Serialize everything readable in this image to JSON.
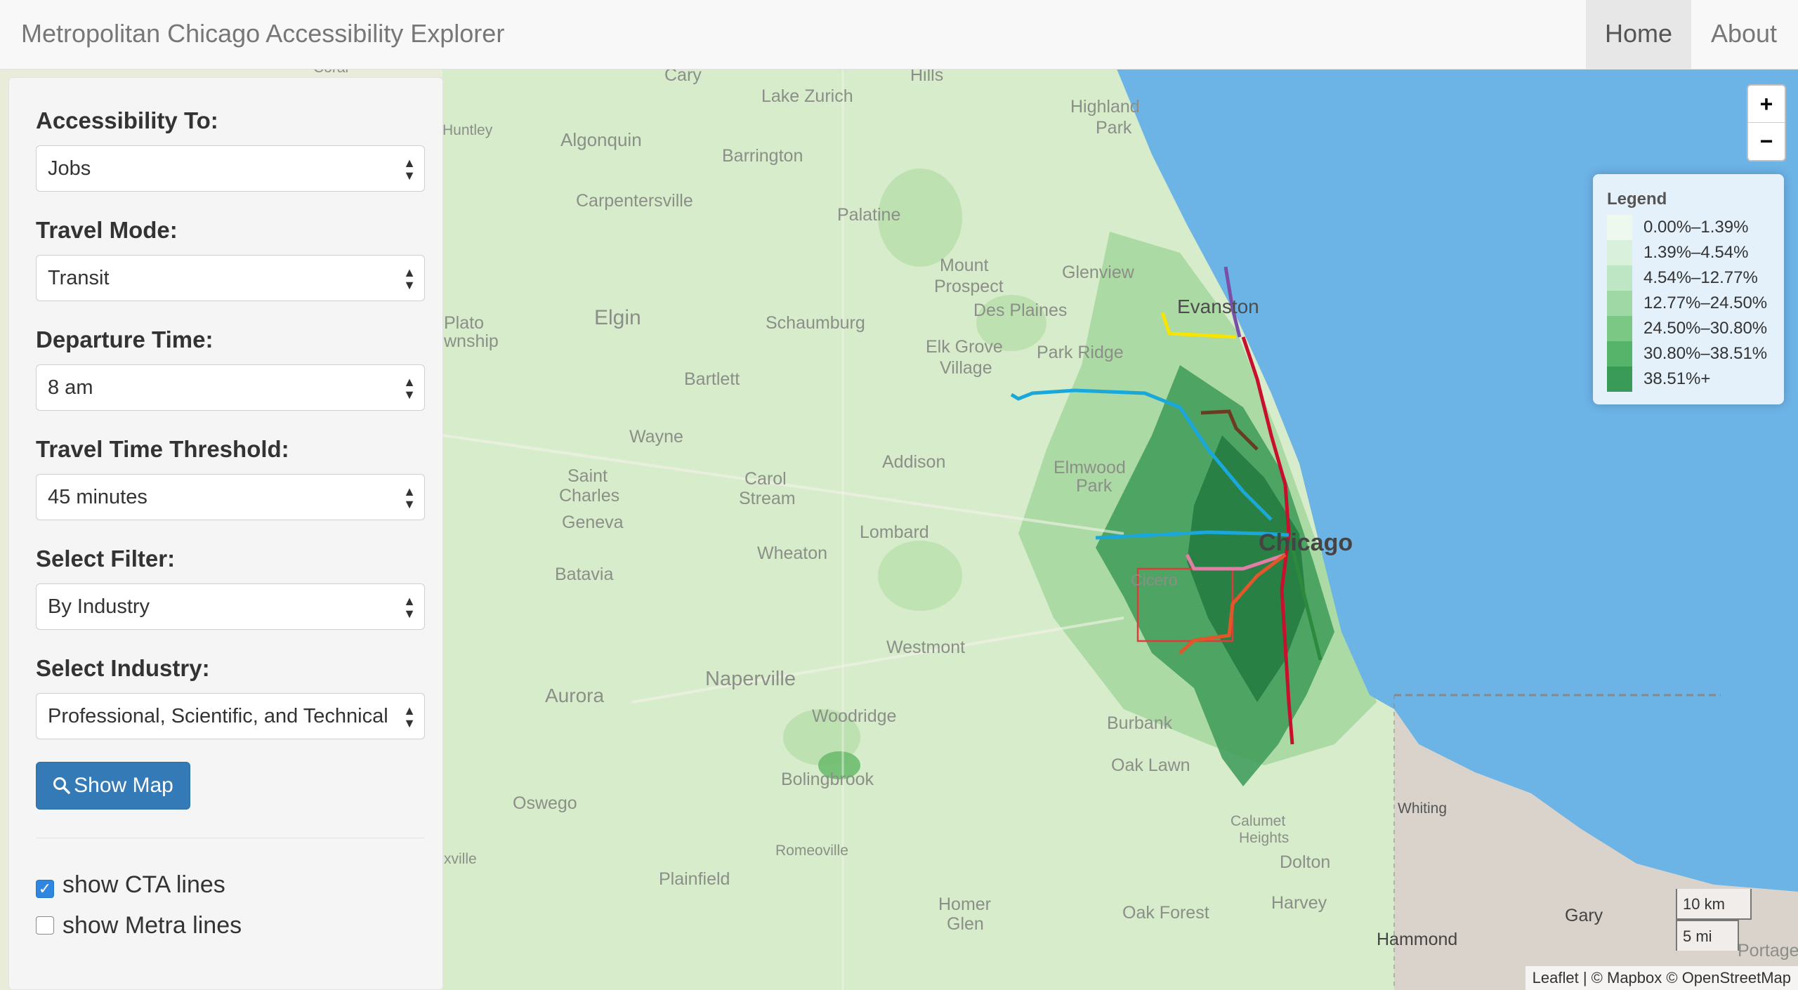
{
  "navbar": {
    "brand": "Metropolitan Chicago Accessibility Explorer",
    "items": [
      {
        "label": "Home",
        "active": true
      },
      {
        "label": "About",
        "active": false
      }
    ]
  },
  "sidebar": {
    "accessibility_to": {
      "label": "Accessibility To:",
      "value": "Jobs"
    },
    "travel_mode": {
      "label": "Travel Mode:",
      "value": "Transit"
    },
    "departure_time": {
      "label": "Departure Time:",
      "value": "8 am"
    },
    "travel_time_threshold": {
      "label": "Travel Time Threshold:",
      "value": "45 minutes"
    },
    "select_filter": {
      "label": "Select Filter:",
      "value": "By Industry"
    },
    "select_industry": {
      "label": "Select Industry:",
      "value": "Professional, Scientific, and Technical"
    },
    "show_map_button": "Show Map",
    "show_cta_lines": {
      "label": "show CTA lines",
      "checked": true
    },
    "show_metra_lines": {
      "label": "show Metra lines",
      "checked": false
    }
  },
  "zoom": {
    "in": "+",
    "out": "−"
  },
  "legend": {
    "title": "Legend",
    "items": [
      {
        "label": "0.00%–1.39%",
        "color": "#edf8ef"
      },
      {
        "label": "1.39%–4.54%",
        "color": "#d8f0dc"
      },
      {
        "label": "4.54%–12.77%",
        "color": "#bfe6c4"
      },
      {
        "label": "12.77%–24.50%",
        "color": "#9fd8a5"
      },
      {
        "label": "24.50%–30.80%",
        "color": "#7bc885"
      },
      {
        "label": "30.80%–38.51%",
        "color": "#55b36a"
      },
      {
        "label": "38.51%+",
        "color": "#3a9a58"
      }
    ]
  },
  "scale": {
    "km": "10 km",
    "mi": "5 mi"
  },
  "attribution": "Leaflet | © Mapbox © OpenStreetMap",
  "map_labels": [
    "Cary",
    "Hills",
    "Lake Zurich",
    "Highland",
    "Park",
    "Huntley",
    "Algonquin",
    "Barrington",
    "Carpentersville",
    "Palatine",
    "Mount",
    "Prospect",
    "Glenview",
    "Evanston",
    "Elgin",
    "Schaumburg",
    "Des Plaines",
    "Elk Grove",
    "Village",
    "Park Ridge",
    "Plato",
    "wnship",
    "Bartlett",
    "Wayne",
    "Addison",
    "Elmwood",
    "Park",
    "Saint",
    "Charles",
    "Carol",
    "Stream",
    "Geneva",
    "Lombard",
    "Chicago",
    "Wheaton",
    "Batavia",
    "Cicero",
    "Westmont",
    "Naperville",
    "Aurora",
    "Woodridge",
    "Burbank",
    "Oak Lawn",
    "Bolingbrook",
    "Oswego",
    "Romeoville",
    "Calumet",
    "Heights",
    "Dolton",
    "Whiting",
    "Plainfield",
    "Homer",
    "Glen",
    "Harvey",
    "Oak Forest",
    "Gary",
    "Hammond",
    "Portage",
    "xville",
    "Coral"
  ],
  "colors": {
    "lake": "#6cb3e6",
    "land": "#e9ecd9",
    "accent": "#337ab7",
    "cta_red": "#c8102e",
    "cta_blue": "#00a1de",
    "cta_purple": "#522398",
    "cta_yellow": "#f9e300",
    "cta_orange": "#f9461c",
    "cta_pink": "#e27ea6",
    "cta_brown": "#62361b"
  }
}
